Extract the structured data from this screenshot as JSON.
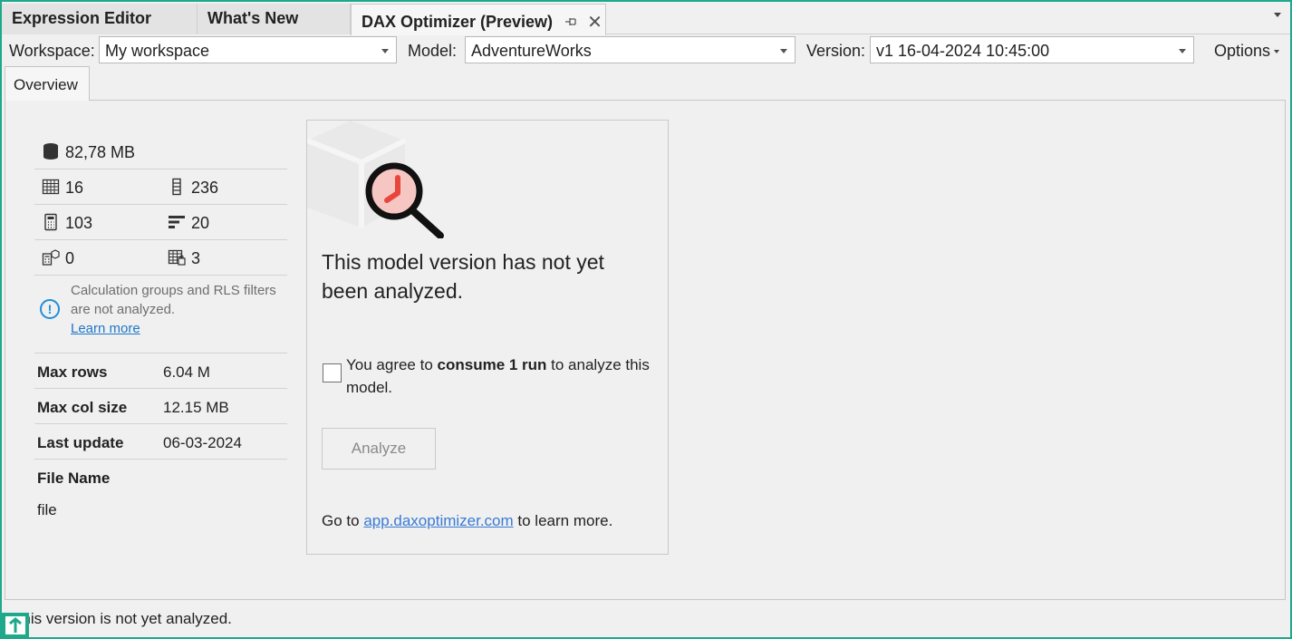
{
  "tabs": {
    "expression_editor": "Expression Editor",
    "whats_new": "What's New",
    "dax_optimizer": "DAX Optimizer (Preview)",
    "pin_glyph": "⊣⊢",
    "close_glyph": "✕"
  },
  "toolbar": {
    "workspace_label": "Workspace:",
    "workspace_value": "My workspace",
    "model_label": "Model:",
    "model_value": "AdventureWorks",
    "version_label": "Version:",
    "version_value": "v1 16-04-2024 10:45:00",
    "options_label": "Options"
  },
  "inner_tabs": {
    "overview": "Overview"
  },
  "stats": {
    "size": "82,78 MB",
    "tables": "16",
    "columns": "236",
    "measures": "103",
    "relationships": "20",
    "calc_groups": "0",
    "rls": "3",
    "info_text": "Calculation groups and RLS filters are not analyzed.",
    "learn_more": "Learn more",
    "info_glyph": "!",
    "max_rows_label": "Max rows",
    "max_rows_value": "6.04 M",
    "max_col_label": "Max col size",
    "max_col_value": "12.15 MB",
    "last_update_label": "Last update",
    "last_update_value": "06-03-2024",
    "file_name_label": "File Name",
    "file_name_value": "file"
  },
  "card": {
    "message": "This model version has not yet been analyzed.",
    "agree_prefix": "You agree to ",
    "agree_bold": "consume 1 run",
    "agree_suffix": " to analyze this model.",
    "analyze_button": "Analyze",
    "goto_prefix": "Go to ",
    "goto_link": "app.daxoptimizer.com",
    "goto_suffix": " to learn more."
  },
  "status": {
    "text": "This version is not yet analyzed."
  },
  "colors": {
    "frame": "#1fa88a",
    "link": "#3a7bd5",
    "info": "#1f8fd8",
    "magnifier_fill": "#f6c6c2",
    "magnifier_mark": "#e8453c"
  },
  "icons": {
    "size": "database-icon",
    "tables": "table-icon",
    "columns": "column-icon",
    "measures": "calculator-icon",
    "relationships": "bars-icon",
    "calc_groups": "calc-group-icon",
    "rls": "rls-table-icon",
    "info": "info-icon",
    "illustration": "magnifier-illustration"
  }
}
